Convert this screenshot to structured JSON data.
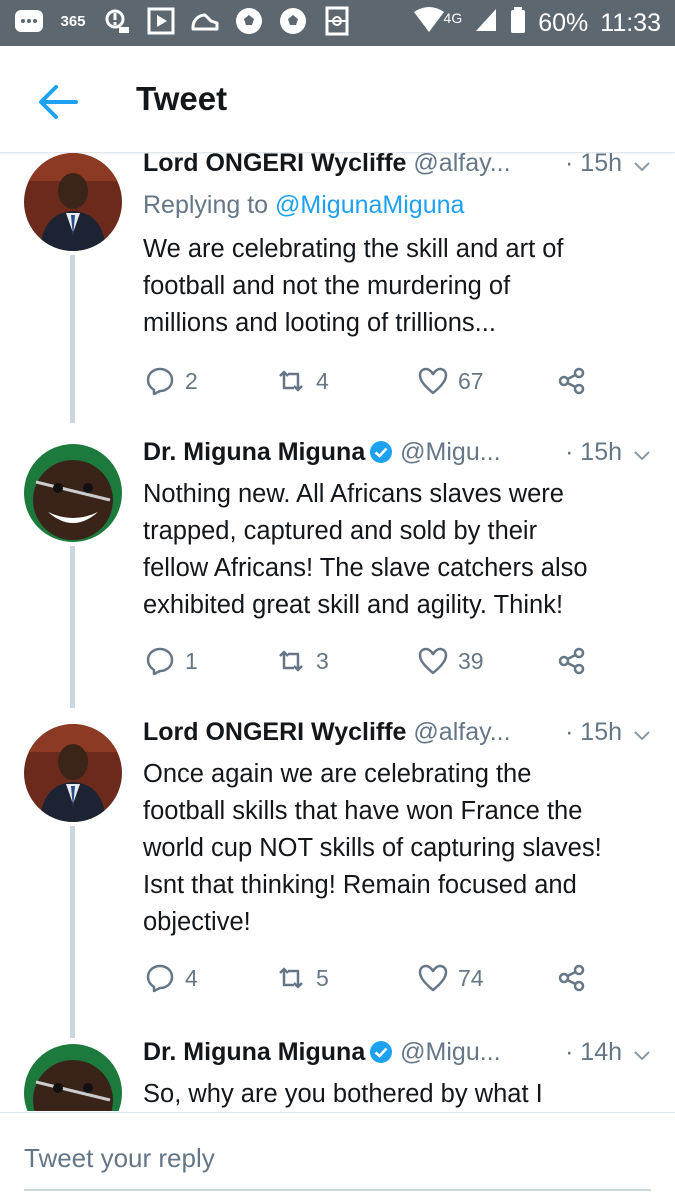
{
  "status_bar": {
    "left_icons": [
      "more-icon",
      "365-app-icon",
      "notification-icon",
      "play-icon",
      "sneaker-icon",
      "soccer-ball-icon",
      "soccer-ball-icon",
      "football-pitch-icon"
    ],
    "app_label_365": "365",
    "network": "4G",
    "battery": "60%",
    "time": "11:33"
  },
  "app_bar": {
    "title": "Tweet",
    "back_icon": "back-arrow-icon"
  },
  "colors": {
    "accent": "#1da1f2",
    "status_bar_bg": "#5d6770",
    "secondary_text": "#657786",
    "thread_line": "#ccd6dd"
  },
  "tweets": [
    {
      "name": "Lord ONGERI Wycliffe",
      "handle": "@alfay...",
      "time": "· 15h",
      "replying_prefix": "Replying to ",
      "replying_mention": "@MigunaMiguna",
      "text_lines": [
        "We are celebrating the skill and art of",
        "football and not the murdering of",
        "millions and looting of trillions..."
      ],
      "replies": "2",
      "retweets": "4",
      "likes": "67",
      "verified": false
    },
    {
      "name": "Dr. Miguna Miguna",
      "handle": "@Migu...",
      "time": "· 15h",
      "text_lines": [
        "Nothing new. All Africans slaves were",
        "trapped, captured and sold by their",
        "fellow Africans! The slave catchers also",
        "exhibited great skill and agility. Think!"
      ],
      "replies": "1",
      "retweets": "3",
      "likes": "39",
      "verified": true
    },
    {
      "name": "Lord ONGERI Wycliffe",
      "handle": "@alfay...",
      "time": "· 15h",
      "text_lines": [
        "Once again we are celebrating the",
        "football skills that have won France the",
        "world cup NOT skills of capturing slaves!",
        "Isnt that thinking! Remain focused and",
        "objective!"
      ],
      "replies": "4",
      "retweets": "5",
      "likes": "74",
      "verified": false
    },
    {
      "name": "Dr. Miguna Miguna",
      "handle": "@Migu...",
      "time": "· 14h",
      "text_lines": [
        "So, why are you bothered by what I"
      ],
      "verified": true
    }
  ],
  "composer": {
    "placeholder": "Tweet your reply"
  }
}
